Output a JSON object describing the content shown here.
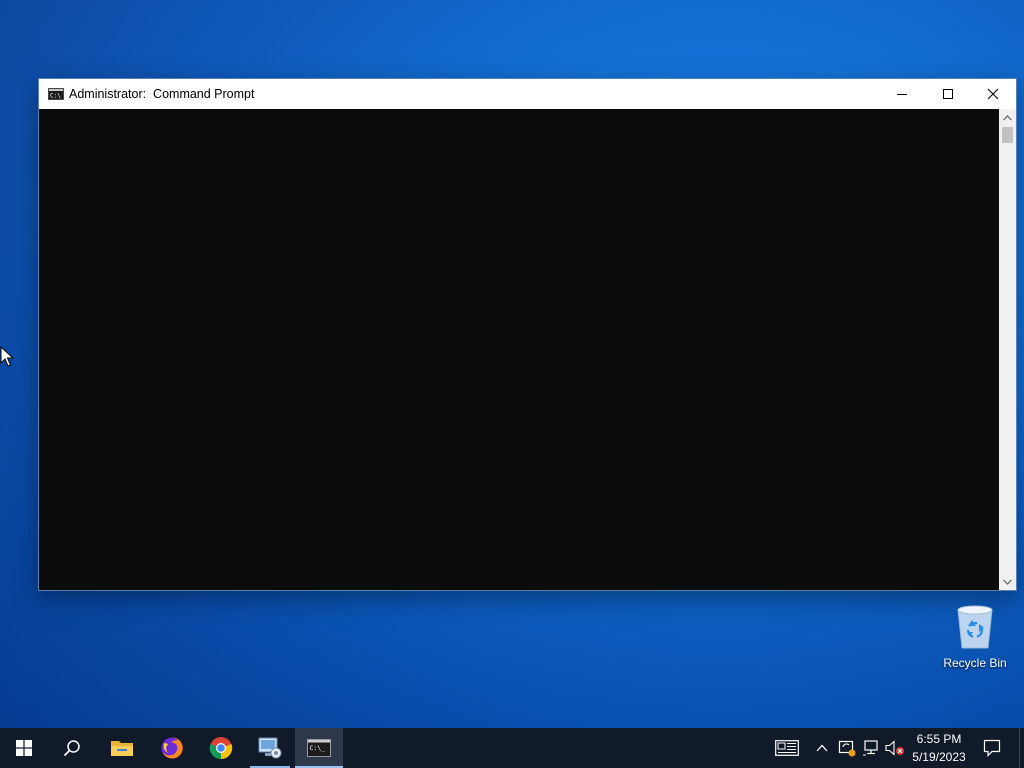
{
  "desktop": {
    "recycle_bin_label": "Recycle Bin"
  },
  "window": {
    "title": "Administrator:  Command Prompt",
    "icon": "cmd-icon",
    "controls": [
      "minimize-icon",
      "maximize-icon",
      "close-icon"
    ],
    "console_text": ""
  },
  "taskbar": {
    "apps": [
      {
        "name": "start",
        "icon": "windows-logo-icon"
      },
      {
        "name": "search",
        "icon": "search-icon"
      },
      {
        "name": "file-explorer",
        "icon": "folder-icon"
      },
      {
        "name": "firefox",
        "icon": "firefox-icon"
      },
      {
        "name": "chrome",
        "icon": "chrome-icon"
      },
      {
        "name": "setup",
        "icon": "setup-icon"
      },
      {
        "name": "command-prompt",
        "icon": "cmd-icon",
        "active": true
      }
    ],
    "tray": {
      "time": "6:55 PM",
      "date": "5/19/2023",
      "icons": [
        "news-icon",
        "chevron-up-icon",
        "update-icon",
        "network-icon",
        "volume-muted-icon",
        "notifications-icon"
      ]
    }
  },
  "colors": {
    "console_bg": "#0c0c0c",
    "taskbar_bg": "#101a28",
    "desktop_accent": "#0f6fd6"
  }
}
